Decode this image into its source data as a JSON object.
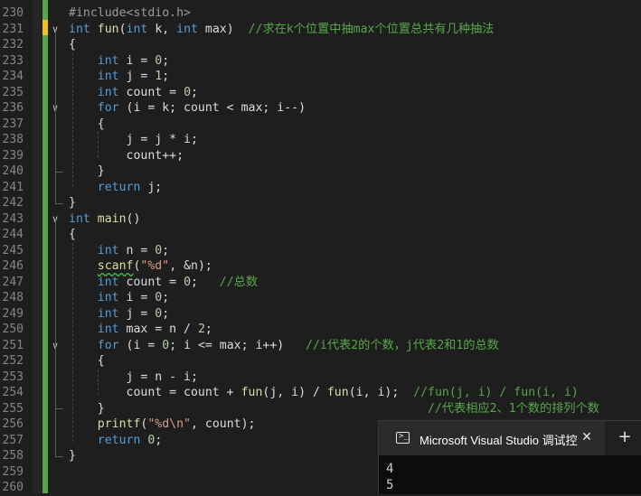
{
  "editor": {
    "line_numbers": [
      "230",
      "231",
      "232",
      "233",
      "234",
      "235",
      "236",
      "237",
      "238",
      "239",
      "240",
      "241",
      "242",
      "243",
      "244",
      "245",
      "246",
      "247",
      "248",
      "249",
      "250",
      "251",
      "252",
      "253",
      "254",
      "255",
      "256",
      "257",
      "258",
      "259",
      "260"
    ],
    "lines": [
      {
        "tokens": [
          {
            "t": "#include<stdio.h>",
            "c": "inc"
          }
        ]
      },
      {
        "tokens": [
          {
            "t": "int ",
            "c": "kw"
          },
          {
            "t": "fun",
            "c": "fn"
          },
          {
            "t": "(",
            "c": ""
          },
          {
            "t": "int",
            "c": "kw"
          },
          {
            "t": " k, ",
            "c": ""
          },
          {
            "t": "int",
            "c": "kw"
          },
          {
            "t": " max)  ",
            "c": ""
          },
          {
            "t": "//求在k个位置中抽max个位置总共有几种抽法",
            "c": "cm"
          }
        ]
      },
      {
        "tokens": [
          {
            "t": "{",
            "c": ""
          }
        ]
      },
      {
        "tokens": [
          {
            "t": "    ",
            "c": ""
          },
          {
            "t": "int",
            "c": "kw"
          },
          {
            "t": " i = ",
            "c": ""
          },
          {
            "t": "0",
            "c": "num"
          },
          {
            "t": ";",
            "c": ""
          }
        ]
      },
      {
        "tokens": [
          {
            "t": "    ",
            "c": ""
          },
          {
            "t": "int",
            "c": "kw"
          },
          {
            "t": " j = ",
            "c": ""
          },
          {
            "t": "1",
            "c": "num"
          },
          {
            "t": ";",
            "c": ""
          }
        ]
      },
      {
        "tokens": [
          {
            "t": "    ",
            "c": ""
          },
          {
            "t": "int",
            "c": "kw"
          },
          {
            "t": " count = ",
            "c": ""
          },
          {
            "t": "0",
            "c": "num"
          },
          {
            "t": ";",
            "c": ""
          }
        ]
      },
      {
        "tokens": [
          {
            "t": "    ",
            "c": ""
          },
          {
            "t": "for",
            "c": "kw"
          },
          {
            "t": " (i = k; count < max; i--)",
            "c": ""
          }
        ]
      },
      {
        "tokens": [
          {
            "t": "    {",
            "c": ""
          }
        ]
      },
      {
        "tokens": [
          {
            "t": "        j = j * i;",
            "c": ""
          }
        ]
      },
      {
        "tokens": [
          {
            "t": "        count++;",
            "c": ""
          }
        ]
      },
      {
        "tokens": [
          {
            "t": "    }",
            "c": ""
          }
        ]
      },
      {
        "tokens": [
          {
            "t": "    ",
            "c": ""
          },
          {
            "t": "return",
            "c": "kw"
          },
          {
            "t": " j;",
            "c": ""
          }
        ]
      },
      {
        "tokens": [
          {
            "t": "}",
            "c": ""
          }
        ]
      },
      {
        "tokens": [
          {
            "t": "int ",
            "c": "kw"
          },
          {
            "t": "main",
            "c": "fn"
          },
          {
            "t": "()",
            "c": ""
          }
        ]
      },
      {
        "tokens": [
          {
            "t": "{",
            "c": ""
          }
        ]
      },
      {
        "tokens": [
          {
            "t": "    ",
            "c": ""
          },
          {
            "t": "int",
            "c": "kw"
          },
          {
            "t": " n = ",
            "c": ""
          },
          {
            "t": "0",
            "c": "num"
          },
          {
            "t": ";",
            "c": ""
          }
        ]
      },
      {
        "tokens": [
          {
            "t": "    ",
            "c": ""
          },
          {
            "t": "scanf",
            "c": "fn squig"
          },
          {
            "t": "(",
            "c": ""
          },
          {
            "t": "\"%d\"",
            "c": "str"
          },
          {
            "t": ", &n);",
            "c": ""
          }
        ]
      },
      {
        "tokens": [
          {
            "t": "    ",
            "c": ""
          },
          {
            "t": "int",
            "c": "kw"
          },
          {
            "t": " count = ",
            "c": ""
          },
          {
            "t": "0",
            "c": "num"
          },
          {
            "t": ";   ",
            "c": ""
          },
          {
            "t": "//总数",
            "c": "cm"
          }
        ]
      },
      {
        "tokens": [
          {
            "t": "    ",
            "c": ""
          },
          {
            "t": "int",
            "c": "kw"
          },
          {
            "t": " i = ",
            "c": ""
          },
          {
            "t": "0",
            "c": "num"
          },
          {
            "t": ";",
            "c": ""
          }
        ]
      },
      {
        "tokens": [
          {
            "t": "    ",
            "c": ""
          },
          {
            "t": "int",
            "c": "kw"
          },
          {
            "t": " j = ",
            "c": ""
          },
          {
            "t": "0",
            "c": "num"
          },
          {
            "t": ";",
            "c": ""
          }
        ]
      },
      {
        "tokens": [
          {
            "t": "    ",
            "c": ""
          },
          {
            "t": "int",
            "c": "kw"
          },
          {
            "t": " max = n / ",
            "c": ""
          },
          {
            "t": "2",
            "c": "num"
          },
          {
            "t": ";",
            "c": ""
          }
        ]
      },
      {
        "tokens": [
          {
            "t": "    ",
            "c": ""
          },
          {
            "t": "for",
            "c": "kw"
          },
          {
            "t": " (i = ",
            "c": ""
          },
          {
            "t": "0",
            "c": "num"
          },
          {
            "t": "; i <= max; i++)   ",
            "c": ""
          },
          {
            "t": "//i代表2的个数，j代表2和1的总数",
            "c": "cm"
          }
        ]
      },
      {
        "tokens": [
          {
            "t": "    {",
            "c": ""
          }
        ]
      },
      {
        "tokens": [
          {
            "t": "        j = n - i;",
            "c": ""
          }
        ]
      },
      {
        "tokens": [
          {
            "t": "        count = count + ",
            "c": ""
          },
          {
            "t": "fun",
            "c": "fn"
          },
          {
            "t": "(j, i) / ",
            "c": ""
          },
          {
            "t": "fun",
            "c": "fn"
          },
          {
            "t": "(i, i);  ",
            "c": ""
          },
          {
            "t": "//fun(j, i) / fun(i, i)",
            "c": "cm"
          }
        ]
      },
      {
        "tokens": [
          {
            "t": "    }                                             ",
            "c": ""
          },
          {
            "t": "//代表相应2、1个数的排列个数",
            "c": "cm"
          }
        ]
      },
      {
        "tokens": [
          {
            "t": "    ",
            "c": ""
          },
          {
            "t": "printf",
            "c": "fn"
          },
          {
            "t": "(",
            "c": ""
          },
          {
            "t": "\"%d\\n\"",
            "c": "str"
          },
          {
            "t": ", count);",
            "c": ""
          }
        ]
      },
      {
        "tokens": [
          {
            "t": "    ",
            "c": ""
          },
          {
            "t": "return",
            "c": "kw"
          },
          {
            "t": " ",
            "c": ""
          },
          {
            "t": "0",
            "c": "num"
          },
          {
            "t": ";",
            "c": ""
          }
        ]
      },
      {
        "tokens": [
          {
            "t": "}",
            "c": ""
          }
        ]
      },
      {
        "tokens": []
      },
      {
        "tokens": []
      }
    ],
    "fold_lines": [
      1,
      6,
      13,
      21
    ],
    "fold_glyph": "∨"
  },
  "console": {
    "title": "Microsoft Visual Studio 调试控",
    "close_glyph": "✕",
    "newtab_glyph": "+",
    "icon_glyph": ">_",
    "output": [
      "4",
      "5"
    ]
  }
}
